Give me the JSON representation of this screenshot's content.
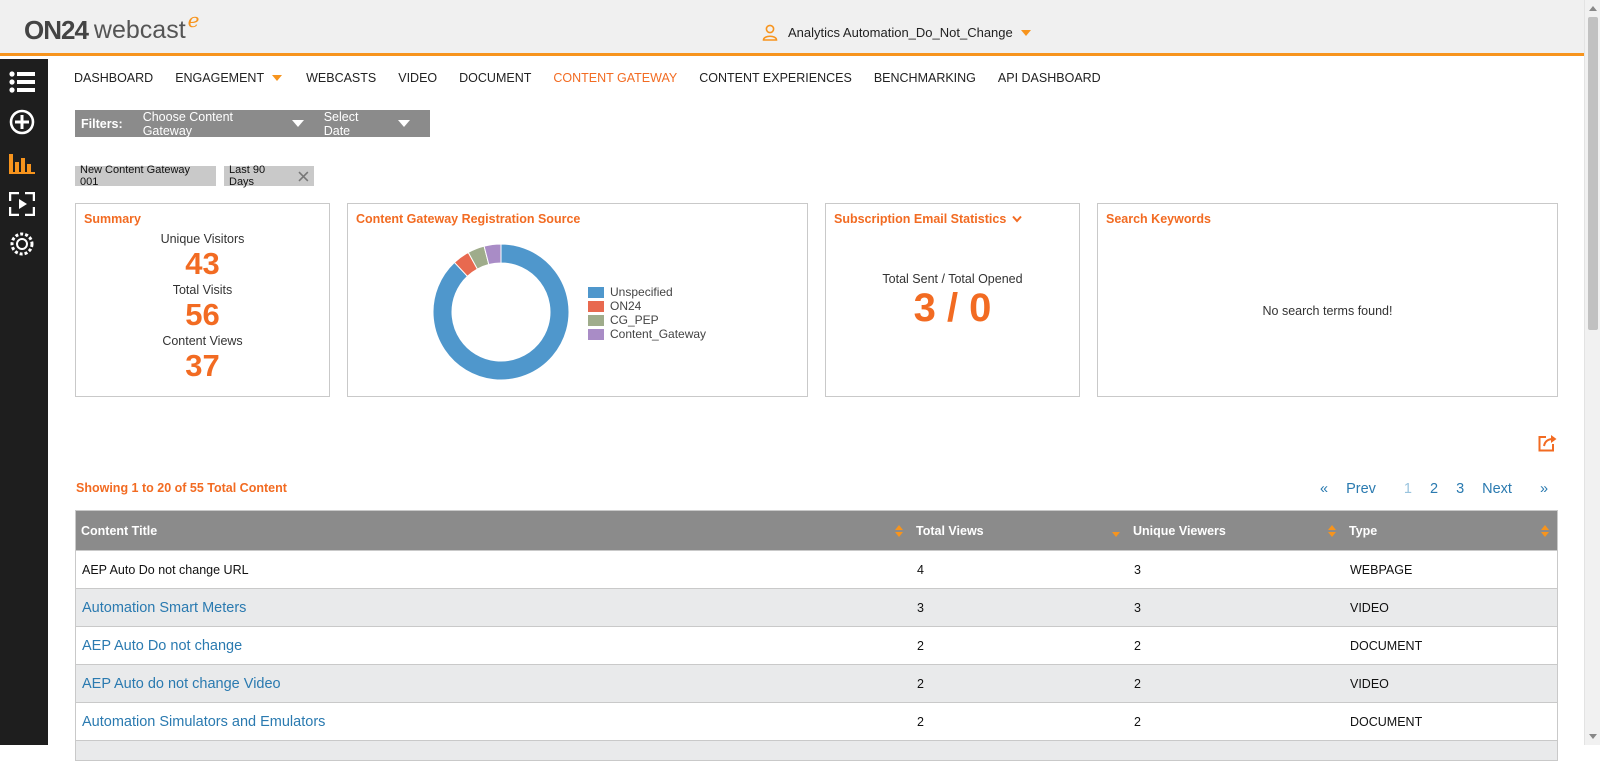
{
  "header": {
    "logo_brand": "ON24",
    "logo_product": "webcast",
    "logo_suffix": "e",
    "user_name": "Analytics Automation_Do_Not_Change"
  },
  "sidebar": {
    "icons": [
      "list-icon",
      "add-circle-icon",
      "analytics-bar-icon",
      "media-player-icon",
      "gear-dotted-icon"
    ]
  },
  "nav": {
    "items": [
      {
        "label": "DASHBOARD",
        "active": false
      },
      {
        "label": "ENGAGEMENT",
        "active": false,
        "dropdown": true
      },
      {
        "label": "WEBCASTS",
        "active": false
      },
      {
        "label": "VIDEO",
        "active": false
      },
      {
        "label": "DOCUMENT",
        "active": false
      },
      {
        "label": "CONTENT GATEWAY",
        "active": true
      },
      {
        "label": "CONTENT EXPERIENCES",
        "active": false
      },
      {
        "label": "BENCHMARKING",
        "active": false
      },
      {
        "label": "API DASHBOARD",
        "active": false
      }
    ]
  },
  "filters": {
    "label": "Filters:",
    "gateway": "Choose Content Gateway",
    "date": "Select Date"
  },
  "tags": {
    "gateway": "New Content Gateway 001",
    "date": "Last 90 Days"
  },
  "summary": {
    "title": "Summary",
    "unique_visitors_label": "Unique Visitors",
    "unique_visitors": "43",
    "total_visits_label": "Total Visits",
    "total_visits": "56",
    "content_views_label": "Content Views",
    "content_views": "37"
  },
  "registration": {
    "title": "Content Gateway Registration Source"
  },
  "chart_data": {
    "type": "pie",
    "donut": true,
    "categories": [
      "Unspecified",
      "ON24",
      "CG_PEP",
      "Content_Gateway"
    ],
    "values": [
      88,
      4,
      4,
      4
    ],
    "colors": [
      "#4f97cc",
      "#e8694f",
      "#9fac8b",
      "#a98cc6"
    ],
    "legend": "right"
  },
  "email_stats": {
    "title": "Subscription Email Statistics",
    "label": "Total Sent / Total Opened",
    "value": "3 / 0"
  },
  "keywords": {
    "title": "Search Keywords",
    "empty": "No search terms found!"
  },
  "listing": {
    "showing": "Showing 1 to 20 of 55 Total Content",
    "pager": {
      "first": "«",
      "prev": "Prev",
      "pages": [
        "1",
        "2",
        "3"
      ],
      "current": "1",
      "next": "Next",
      "last": "»"
    }
  },
  "table": {
    "headers": [
      "Content Title",
      "Total Views",
      "Unique Viewers",
      "Type"
    ],
    "rows": [
      {
        "title": "AEP Auto Do not change URL",
        "views": "4",
        "unique": "3",
        "type": "WEBPAGE",
        "link": false
      },
      {
        "title": "Automation Smart Meters",
        "views": "3",
        "unique": "3",
        "type": "VIDEO",
        "link": true
      },
      {
        "title": "AEP Auto Do not change",
        "views": "2",
        "unique": "2",
        "type": "DOCUMENT",
        "link": true
      },
      {
        "title": "AEP Auto do not change Video",
        "views": "2",
        "unique": "2",
        "type": "VIDEO",
        "link": true
      },
      {
        "title": "Automation Simulators and Emulators",
        "views": "2",
        "unique": "2",
        "type": "DOCUMENT",
        "link": true
      }
    ]
  },
  "colors": {
    "accent": "#f26b22",
    "link": "#2a7ab0",
    "header_gray": "#8b8b8b",
    "sidebar": "#1e1e1e"
  }
}
